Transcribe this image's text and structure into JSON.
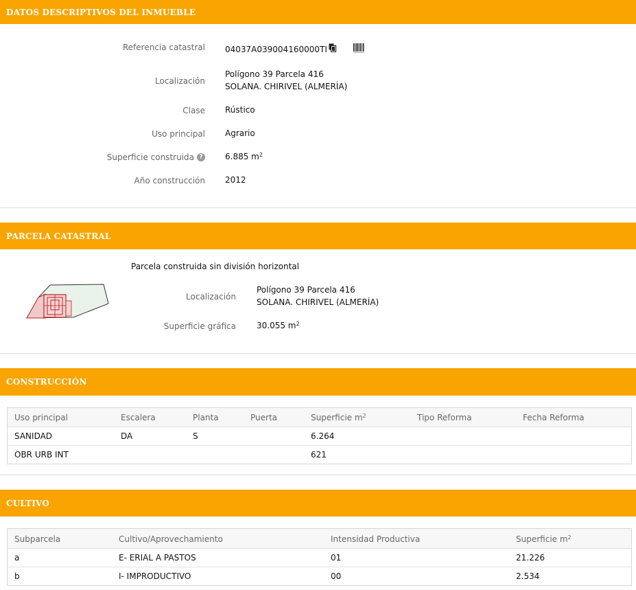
{
  "sections": {
    "datos": {
      "title": "DATOS DESCRIPTIVOS DEL INMUEBLE"
    },
    "parcela": {
      "title": "PARCELA CATASTRAL"
    },
    "construccion": {
      "title": "CONSTRUCCIÓN"
    },
    "cultivo": {
      "title": "CULTIVO"
    }
  },
  "inmueble": {
    "referencia_label": "Referencia catastral",
    "referencia_value": "04037A039004160000TI",
    "localizacion_label": "Localización",
    "localizacion_line1": "Polígono 39 Parcela 416",
    "localizacion_line2": "SOLANA. CHIRIVEL (ALMERÍA)",
    "clase_label": "Clase",
    "clase_value": "Rústico",
    "uso_label": "Uso principal",
    "uso_value": "Agrario",
    "superficie_label": "Superficie construida",
    "superficie_value": "6.885 m",
    "superficie_sup": "2",
    "info_glyph": "?",
    "anio_label": "Año construcción",
    "anio_value": "2012"
  },
  "parcela": {
    "tipo": "Parcela construida sin división horizontal",
    "localizacion_label": "Localización",
    "localizacion_line1": "Polígono 39 Parcela 416",
    "localizacion_line2": "SOLANA. CHIRIVEL (ALMERÍA)",
    "superficie_label": "Superficie gráfica",
    "superficie_value": "30.055 m",
    "superficie_sup": "2"
  },
  "construccion": {
    "headers": [
      "Uso principal",
      "Escalera",
      "Planta",
      "Puerta",
      "Superficie m",
      "Tipo Reforma",
      "Fecha Reforma"
    ],
    "header_sup": "2",
    "rows": [
      [
        "SANIDAD",
        "DA",
        "S",
        "",
        "6.264",
        "",
        ""
      ],
      [
        "OBR URB INT",
        "",
        "",
        "",
        "621",
        "",
        ""
      ]
    ]
  },
  "cultivo": {
    "headers": [
      "Subparcela",
      "Cultivo/Aprovechamiento",
      "Intensidad Productiva",
      "Superficie m"
    ],
    "header_sup": "2",
    "rows": [
      [
        "a",
        "E- ERIAL A PASTOS",
        "01",
        "21.226"
      ],
      [
        "b",
        "I- IMPRODUCTIVO",
        "00",
        "2.534"
      ]
    ]
  },
  "colors": {
    "header_bg": "#f9a400",
    "header_text": "#ffffff"
  },
  "icons": [
    "copy-icon",
    "barcode-icon",
    "info-icon",
    "parcel-map-thumbnail"
  ]
}
